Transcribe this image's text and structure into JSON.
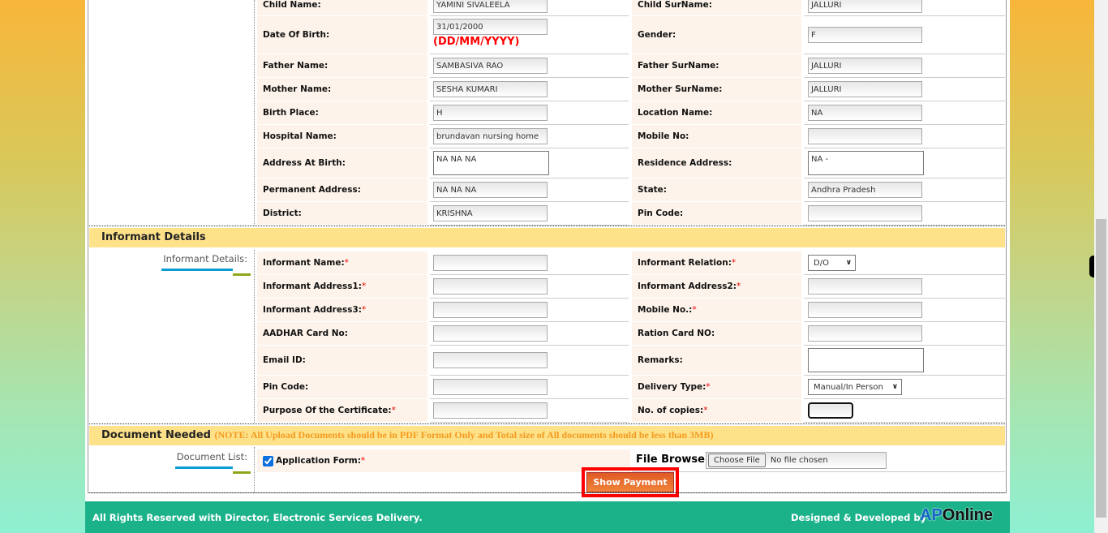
{
  "child_rows": [
    [
      {
        "label": "Child Name:",
        "value": "YAMINI SIVALEELA"
      },
      {
        "label": "Child SurName:",
        "value": "JALLURI"
      }
    ],
    [
      {
        "label": "Date Of Birth:",
        "value": "31/01/2000",
        "hint": "(DD/MM/YYYY)"
      },
      {
        "label": "Gender:",
        "value": "F"
      }
    ],
    [
      {
        "label": "Father Name:",
        "value": "SAMBASIVA RAO"
      },
      {
        "label": "Father SurName:",
        "value": "JALLURI"
      }
    ],
    [
      {
        "label": "Mother Name:",
        "value": "SESHA KUMARI"
      },
      {
        "label": "Mother SurName:",
        "value": "JALLURI"
      }
    ],
    [
      {
        "label": "Birth Place:",
        "value": "H"
      },
      {
        "label": "Location Name:",
        "value": "NA"
      }
    ],
    [
      {
        "label": "Hospital Name:",
        "value": "brundavan nursing home"
      },
      {
        "label": "Mobile No:",
        "value": ""
      }
    ],
    [
      {
        "label": "Address At Birth:",
        "value": "NA NA NA",
        "type": "textarea"
      },
      {
        "label": "Residence Address:",
        "value": "NA -",
        "type": "textarea"
      }
    ],
    [
      {
        "label": "Permanent Address:",
        "value": "NA NA NA"
      },
      {
        "label": "State:",
        "value": "Andhra Pradesh"
      }
    ],
    [
      {
        "label": "District:",
        "value": "KRISHNA"
      },
      {
        "label": "Pin Code:",
        "value": ""
      }
    ]
  ],
  "informant": {
    "title": "Informant Details",
    "side_label": "Informant Details:",
    "rows": [
      [
        {
          "label": "Informant Name:",
          "req": true,
          "value": ""
        },
        {
          "label": "Informant Relation:",
          "req": true,
          "type": "select",
          "value": "D/O"
        }
      ],
      [
        {
          "label": "Informant Address1:",
          "req": true,
          "value": ""
        },
        {
          "label": "Informant Address2:",
          "req": true,
          "value": ""
        }
      ],
      [
        {
          "label": "Informant Address3:",
          "req": true,
          "value": ""
        },
        {
          "label": "Mobile No.:",
          "req": true,
          "value": ""
        }
      ],
      [
        {
          "label": "AADHAR Card No:",
          "value": ""
        },
        {
          "label": "Ration Card NO:",
          "value": ""
        }
      ],
      [
        {
          "label": "Email ID:",
          "value": ""
        },
        {
          "label": "Remarks:",
          "type": "textarea",
          "value": ""
        }
      ],
      [
        {
          "label": "Pin Code:",
          "value": ""
        },
        {
          "label": "Delivery Type:",
          "req": true,
          "type": "select",
          "value": "Manual/In Person"
        }
      ],
      [
        {
          "label": "Purpose Of the Certificate:",
          "req": true,
          "value": ""
        },
        {
          "label": "No. of copies:",
          "req": true,
          "value": "",
          "focused": true
        }
      ]
    ]
  },
  "documents": {
    "title": "Document Needed",
    "note": "(NOTE: All Upload Documents should be in PDF Format Only and Total size of All documents should be less than 3MB)",
    "side_label": "Document List:",
    "item_label": "Application Form:",
    "item_checked": true,
    "file_browse_label": "File Browse",
    "choose_file": "Choose File",
    "no_file": "No file chosen",
    "show_payment": "Show Payment"
  },
  "required_mark": "*",
  "footer": {
    "left": "All Rights Reserved with Director, Electronic Services Delivery.",
    "right": "Designed & Developed by",
    "logo": "APOnline"
  },
  "colors": {
    "section": "#fee28a",
    "label_bg": "#fdf3ea",
    "footer": "#1bb28a",
    "button": "#e8672a",
    "highlight": "#ff0000"
  }
}
